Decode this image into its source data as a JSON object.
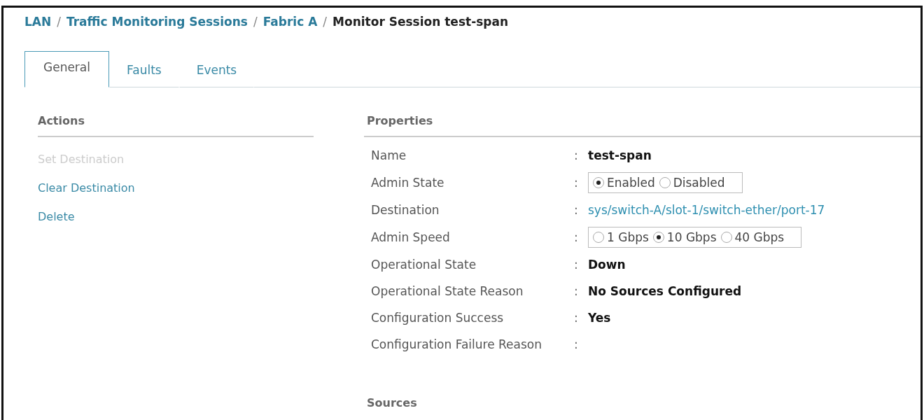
{
  "breadcrumb": [
    {
      "label": "LAN",
      "kind": "link"
    },
    {
      "label": "/",
      "kind": "separator"
    },
    {
      "label": "Traffic Monitoring Sessions",
      "kind": "link"
    },
    {
      "label": "/",
      "kind": "separator"
    },
    {
      "label": "Fabric A",
      "kind": "link"
    },
    {
      "label": "/",
      "kind": "separator"
    },
    {
      "label": "Monitor Session test-span",
      "kind": "current"
    }
  ],
  "tabs": [
    {
      "label": "General",
      "selected": true
    },
    {
      "label": "Faults",
      "selected": false
    },
    {
      "label": "Events",
      "selected": false
    }
  ],
  "actions": {
    "title": "Actions",
    "items": [
      {
        "label": "Set Destination",
        "disabled": true
      },
      {
        "label": "Clear Destination",
        "disabled": false
      },
      {
        "label": "Delete",
        "disabled": false
      }
    ]
  },
  "properties": {
    "title": "Properties",
    "rows": [
      {
        "label": "Name",
        "colon": ":",
        "kind": "text",
        "value": "test-span"
      },
      {
        "label": "Admin State",
        "colon": ":",
        "kind": "radio",
        "options": [
          {
            "label": "Enabled",
            "selected": true
          },
          {
            "label": "Disabled",
            "selected": false
          }
        ]
      },
      {
        "label": "Destination",
        "colon": ":",
        "kind": "link",
        "value": "sys/switch-A/slot-1/switch-ether/port-17"
      },
      {
        "label": "Admin Speed",
        "colon": ":",
        "kind": "radio",
        "options": [
          {
            "label": "1 Gbps",
            "selected": false
          },
          {
            "label": "10 Gbps",
            "selected": true
          },
          {
            "label": "40 Gbps",
            "selected": false
          }
        ]
      },
      {
        "label": "Operational State",
        "colon": ":",
        "kind": "text",
        "value": "Down"
      },
      {
        "label": "Operational State Reason",
        "colon": ":",
        "kind": "text",
        "value": "No Sources Configured"
      },
      {
        "label": "Configuration Success",
        "colon": ":",
        "kind": "text",
        "value": "Yes"
      },
      {
        "label": "Configuration Failure Reason",
        "colon": ":",
        "kind": "empty"
      }
    ]
  },
  "sources": {
    "title": "Sources"
  }
}
